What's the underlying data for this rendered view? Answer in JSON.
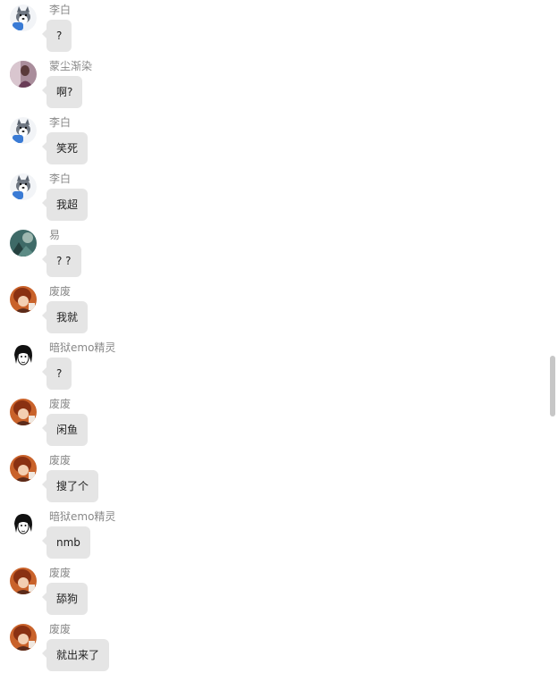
{
  "messages": [
    {
      "sender": "李白",
      "text": "?",
      "avatar": "husky-avatar-icon"
    },
    {
      "sender": "蒙尘渐染",
      "text": "啊?",
      "avatar": "portrait-avatar-icon"
    },
    {
      "sender": "李白",
      "text": "笑死",
      "avatar": "husky-avatar-icon"
    },
    {
      "sender": "李白",
      "text": "我超",
      "avatar": "husky-avatar-icon"
    },
    {
      "sender": "易",
      "text": "? ?",
      "avatar": "scene-avatar-icon"
    },
    {
      "sender": "废废",
      "text": "我就",
      "avatar": "anime-avatar-icon"
    },
    {
      "sender": "暗狱emo精灵",
      "text": "?",
      "avatar": "sketch-face-avatar-icon"
    },
    {
      "sender": "废废",
      "text": "闲鱼",
      "avatar": "anime-avatar-icon"
    },
    {
      "sender": "废废",
      "text": "搜了个",
      "avatar": "anime-avatar-icon"
    },
    {
      "sender": "暗狱emo精灵",
      "text": "nmb",
      "avatar": "sketch-face-avatar-icon"
    },
    {
      "sender": "废废",
      "text": "舔狗",
      "avatar": "anime-avatar-icon"
    },
    {
      "sender": "废废",
      "text": "就出来了",
      "avatar": "anime-avatar-icon"
    }
  ],
  "colors": {
    "bubble": "#e5e5e5",
    "sender_name": "#888888",
    "message_text": "#222222",
    "scrollbar_thumb": "#c7c7c7"
  }
}
